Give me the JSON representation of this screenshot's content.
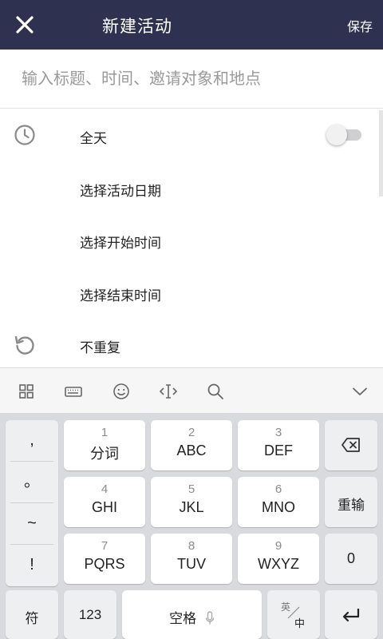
{
  "header": {
    "title": "新建活动",
    "save_label": "保存",
    "close_icon": "close-icon"
  },
  "form": {
    "title_placeholder": "输入标题、时间、邀请对象和地点",
    "title_value": "",
    "rows": [
      {
        "label": "全天",
        "icon": "clock-icon",
        "toggle_on": false
      },
      {
        "label": "选择活动日期"
      },
      {
        "label": "选择开始时间"
      },
      {
        "label": "选择结束时间"
      },
      {
        "label": "不重复",
        "icon": "repeat-icon"
      }
    ]
  },
  "keyboard_toolbar": {
    "icons": [
      "grid-icon",
      "keyboard-icon",
      "emoji-icon",
      "cursor-icon",
      "search-icon",
      "chevron-down-icon"
    ]
  },
  "keyboard": {
    "punctuation": [
      ",",
      "。",
      "~",
      "!"
    ],
    "keys": [
      {
        "num": "1",
        "label": "分词"
      },
      {
        "num": "2",
        "label": "ABC"
      },
      {
        "num": "3",
        "label": "DEF"
      },
      {
        "num": "4",
        "label": "GHI"
      },
      {
        "num": "5",
        "label": "JKL"
      },
      {
        "num": "6",
        "label": "MNO"
      },
      {
        "num": "7",
        "label": "PQRS"
      },
      {
        "num": "8",
        "label": "TUV"
      },
      {
        "num": "9",
        "label": "WXYZ"
      }
    ],
    "backspace_icon": "backspace-icon",
    "reenter_label": "重输",
    "zero_label": "0",
    "symbol_label": "符",
    "number_label": "123",
    "space_label": "空格",
    "mic_icon": "mic-icon",
    "lang_top": "英",
    "lang_bottom": "中",
    "enter_icon": "enter-icon"
  },
  "colors": {
    "header_bg": "#2f3150",
    "keyboard_bg": "#d9dadd",
    "toolbar_bg": "#f6f6f7"
  }
}
